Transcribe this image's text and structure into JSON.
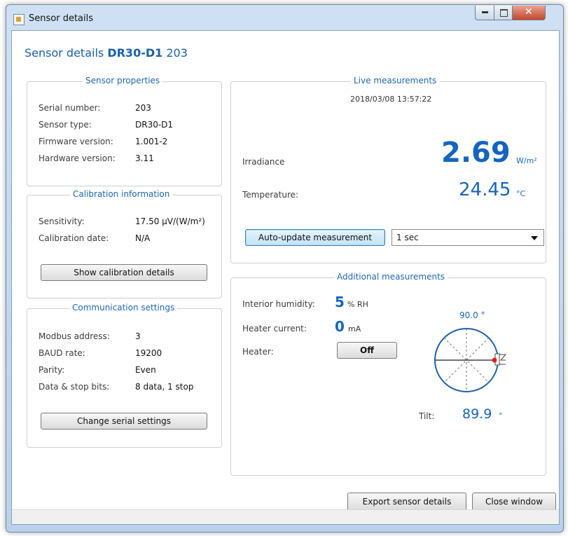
{
  "window": {
    "title": "Sensor details"
  },
  "heading": {
    "prefix": "Sensor details",
    "model": "DR30-D1",
    "serial": "203"
  },
  "sensor_properties": {
    "title": "Sensor properties",
    "rows": [
      {
        "label": "Serial number:",
        "value": "203"
      },
      {
        "label": "Sensor type:",
        "value": "DR30-D1"
      },
      {
        "label": "Firmware version:",
        "value": "1.001-2"
      },
      {
        "label": "Hardware version:",
        "value": "3.11"
      }
    ]
  },
  "calibration": {
    "title": "Calibration information",
    "rows": [
      {
        "label": "Sensitivity:",
        "value": "17.50 μV/(W/m²)"
      },
      {
        "label": "Calibration date:",
        "value": "N/A"
      }
    ],
    "button": "Show calibration details"
  },
  "communication": {
    "title": "Communication settings",
    "rows": [
      {
        "label": "Modbus address:",
        "value": "3"
      },
      {
        "label": "BAUD rate:",
        "value": "19200"
      },
      {
        "label": "Parity:",
        "value": "Even"
      },
      {
        "label": "Data & stop bits:",
        "value": "8 data, 1 stop"
      }
    ],
    "button": "Change serial settings"
  },
  "live": {
    "title": "Live measurements",
    "timestamp": "2018/03/08 13:57:22",
    "irradiance_label": "Irradiance",
    "irradiance_value": "2.69",
    "irradiance_unit": "W/m²",
    "temperature_label": "Temperature:",
    "temperature_value": "24.45",
    "temperature_unit": "°C",
    "auto_update_button": "Auto-update measurement",
    "interval_selected": "1 sec"
  },
  "additional": {
    "title": "Additional measurements",
    "humidity_label": "Interior humidity:",
    "humidity_value": "5",
    "humidity_unit": "% RH",
    "heater_current_label": "Heater current:",
    "heater_current_value": "0",
    "heater_current_unit": "mA",
    "heater_label": "Heater:",
    "heater_button": "Off",
    "tilt_top_label": "90.0 °",
    "tilt_label": "Tilt:",
    "tilt_value": "89.9",
    "tilt_unit": "°"
  },
  "footer": {
    "export_button": "Export sensor details",
    "close_button": "Close window"
  },
  "colors": {
    "accent": "#1565c0",
    "heading": "#1b5fa8",
    "group_title": "#1f66ad",
    "tilt_dot": "#e01e1e"
  }
}
